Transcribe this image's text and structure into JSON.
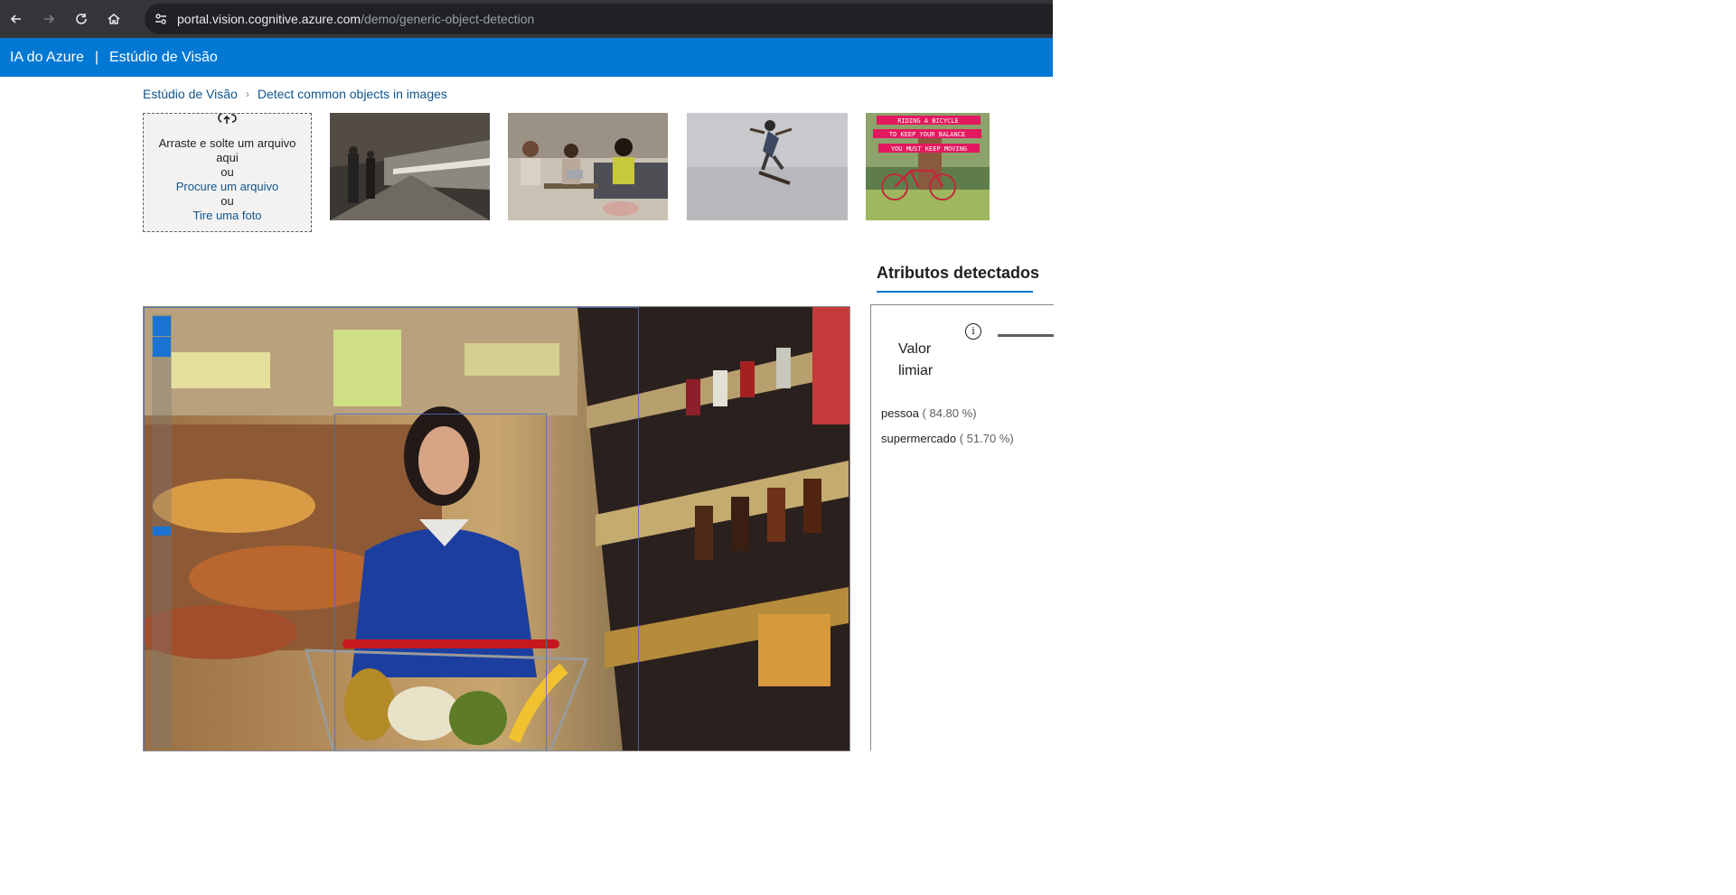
{
  "browser": {
    "url_domain": "portal.vision.cognitive.azure.com",
    "url_path": "/demo/generic-object-detection",
    "icons": [
      "back-arrow-icon",
      "forward-arrow-icon",
      "reload-icon",
      "home-icon",
      "site-settings-icon"
    ]
  },
  "header": {
    "brand": "IA do Azure",
    "separator": "|",
    "product": "Estúdio de Visão"
  },
  "breadcrumb": {
    "root": "Estúdio de Visão",
    "current": "Detect common objects in images"
  },
  "upload": {
    "drag_text": "Arraste e solte um arquivo aqui",
    "or1": "ou",
    "browse_link": "Procure um arquivo",
    "or2": "ou",
    "photo_link": "Tire uma foto"
  },
  "thumbnails": [
    {
      "subject": "train station platform"
    },
    {
      "subject": "people meeting on sofa"
    },
    {
      "subject": "skateboarder jumping"
    },
    {
      "subject": "bicycle with quote"
    }
  ],
  "thumbnail_text": {
    "line1": "RIDING A BICYCLE",
    "line2": "TO KEEP YOUR BALANCE",
    "line3": "YOU MUST KEEP MOVING"
  },
  "panel": {
    "tab_label": "Atributos detectados",
    "threshold_label": "Valor limiar",
    "info_icon_glyph": "i",
    "results": [
      {
        "label": "pessoa",
        "score": "( 84.80 %)"
      },
      {
        "label": "supermercado",
        "score": "( 51.70 %)"
      }
    ]
  },
  "colors": {
    "azure_blue": "#0078d4",
    "link": "#0f548c",
    "browser_dark": "#35363a"
  }
}
